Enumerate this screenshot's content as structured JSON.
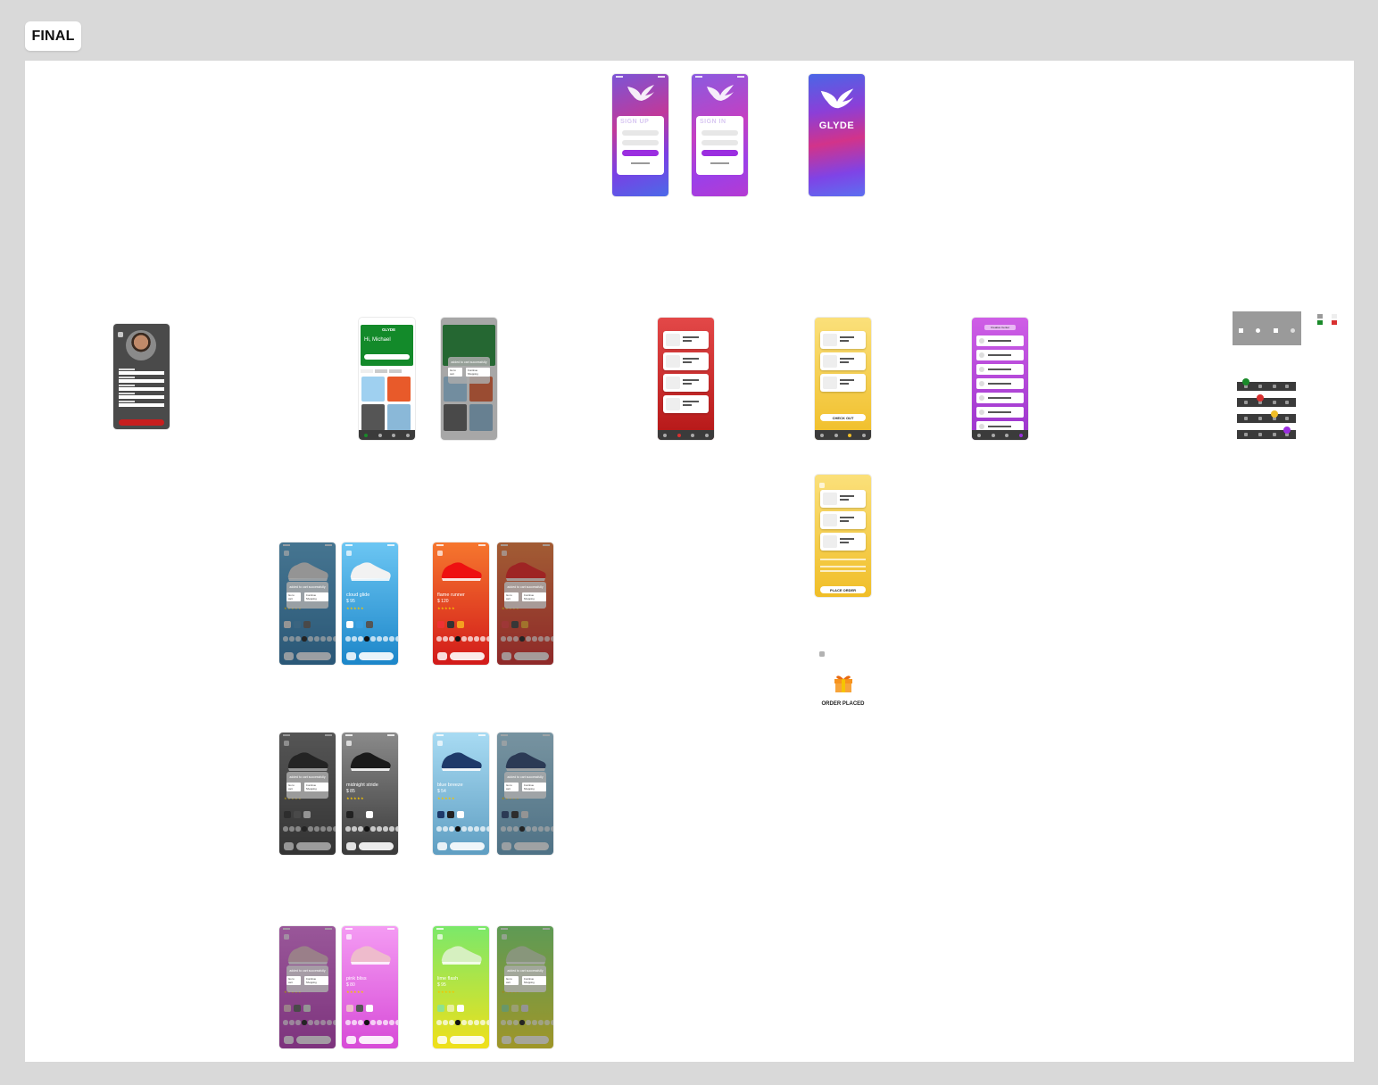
{
  "frame": {
    "title": "FINAL"
  },
  "auth": {
    "signup_title": "SIGN UP",
    "signin_title": "SIGN IN",
    "brand": "GLYDE"
  },
  "home": {
    "brand": "GLYDE",
    "greeting": "Hi, Michael"
  },
  "toast": {
    "message": "added to cart successfully",
    "go_to_cart": "Go to cart",
    "continue": "Continue Shopping"
  },
  "products": [
    {
      "name": "cloud glide",
      "price": "$ 95"
    },
    {
      "name": "flame runner",
      "price": "$ 120"
    },
    {
      "name": "midnight stride",
      "price": "$ 85"
    },
    {
      "name": "blue breeze",
      "price": "$ 54"
    },
    {
      "name": "pink bliss",
      "price": "$ 80"
    },
    {
      "name": "lime flash",
      "price": "$ 95"
    }
  ],
  "cart": {
    "checkout": "CHECK OUT",
    "place_order": "PLACE ORDER"
  },
  "settings": {
    "title": "Creative Center"
  },
  "order": {
    "placed": "ORDER PLACED"
  },
  "colors": {
    "purple": "#9b2ee0",
    "green": "#1a8a2a",
    "yellow": "#f8d24a",
    "red": "#d93030"
  }
}
